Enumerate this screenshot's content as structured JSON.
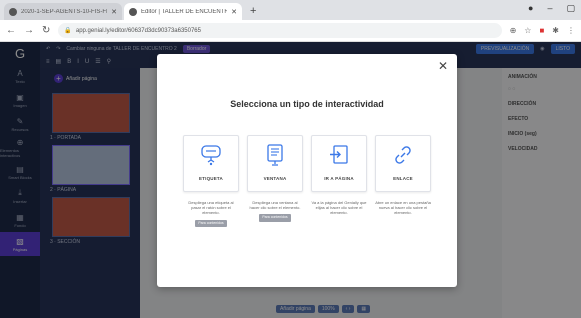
{
  "browser": {
    "tabs": [
      {
        "title": "2020-1-SEP-AGENTS-10-FIS-FILE-1 x",
        "active": false
      },
      {
        "title": "Editor | TALLER DE ENCUENTRO | G",
        "active": true
      }
    ],
    "url": "app.genial.ly/editor/60637d3dc90373a6350765"
  },
  "rail": {
    "items": [
      {
        "icon": "A",
        "label": "Texto"
      },
      {
        "icon": "▣",
        "label": "Imagen"
      },
      {
        "icon": "✎",
        "label": "Recursos"
      },
      {
        "icon": "⊕",
        "label": "Elementos interactivos"
      },
      {
        "icon": "▤",
        "label": "Smart Blocks"
      },
      {
        "icon": "⤓",
        "label": "Insertar"
      },
      {
        "icon": "▦",
        "label": "Fondo"
      },
      {
        "icon": "▧",
        "label": "Páginas"
      }
    ]
  },
  "toolbar": {
    "title": "Cambiar ninguna de   TALLER DE ENCUENTRO 2",
    "badge": "Borrador",
    "preview": "PREVISUALIZACIÓN",
    "edit": "LISTO"
  },
  "pages": {
    "add_label": "Añadir página",
    "thumbs": [
      {
        "text": "TALLER DE LOS DEPREDADORES",
        "label": "1 · PORTADA"
      },
      {
        "text": "",
        "label": "2 · PÁGINA"
      },
      {
        "text": "",
        "label": "3 · SECCIÓN"
      }
    ]
  },
  "right_panel": {
    "animation": "ANIMACIÓN",
    "direction": "DIRECCIÓN",
    "effect": "EFECTO",
    "delay": "INICIO (seg)",
    "speed": "VELOCIDAD"
  },
  "bottom": {
    "add_page": "Añadir página",
    "zoom": "100%"
  },
  "modal": {
    "title": "Selecciona un tipo de interactividad",
    "cards": [
      {
        "label": "ETIQUETA",
        "desc": "Despliega una etiqueta al pasar el ratón sobre el elemento.",
        "tag": "Para contenidos"
      },
      {
        "label": "VENTANA",
        "desc": "Despliega una ventana al hacer clic sobre el elemento.",
        "tag": "Para contenidos"
      },
      {
        "label": "IR A PÁGINA",
        "desc": "Va a la página del Genially que elijas al hacer clic sobre el elemento.",
        "tag": ""
      },
      {
        "label": "ENLACE",
        "desc": "Abre un enlace en una pestaña nueva al hacer clic sobre el elemento.",
        "tag": ""
      }
    ]
  },
  "colors": {
    "accent": "#3b78e7",
    "rail": "#1e2b4a",
    "selected": "#5b3fd6"
  }
}
